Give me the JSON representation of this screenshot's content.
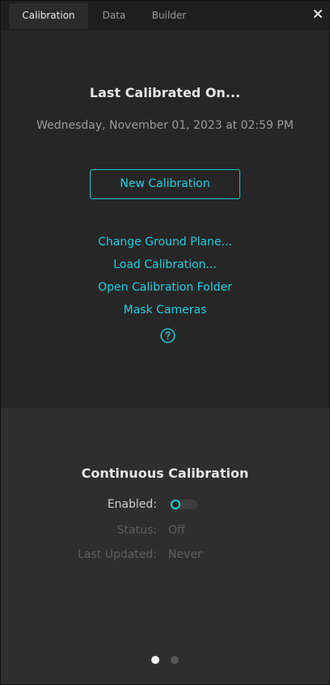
{
  "tabs": [
    {
      "label": "Calibration",
      "active": true
    },
    {
      "label": "Data",
      "active": false
    },
    {
      "label": "Builder",
      "active": false
    }
  ],
  "close_icon": "close-icon",
  "calibration": {
    "title": "Last Calibrated On...",
    "date": "Wednesday, November 01, 2023 at 02:59 PM",
    "new_button": "New Calibration",
    "links": [
      "Change Ground Plane...",
      "Load Calibration...",
      "Open Calibration Folder",
      "Mask Cameras"
    ],
    "help_icon": "help-circle-icon"
  },
  "continuous": {
    "title": "Continuous Calibration",
    "enabled_label": "Enabled:",
    "enabled": false,
    "status_label": "Status:",
    "status_value": "Off",
    "last_updated_label": "Last Updated:",
    "last_updated_value": "Never"
  },
  "pagination": {
    "pages": 2,
    "current": 1
  },
  "colors": {
    "accent": "#1fd0e3",
    "background": "#262626",
    "panel_lower": "#2e2e2e"
  }
}
